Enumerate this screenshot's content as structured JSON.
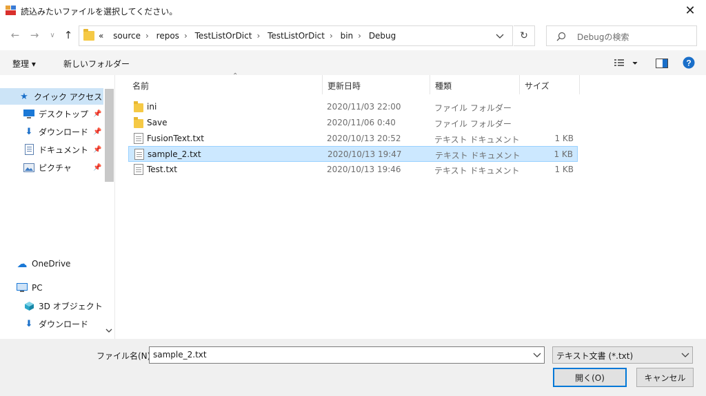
{
  "window": {
    "title": "読込みたいファイルを選択してください。"
  },
  "nav": {
    "back": "←",
    "forward": "→",
    "history": "∨",
    "up": "↑",
    "crumbs_prefix": "«",
    "crumbs": [
      "source",
      "repos",
      "TestListOrDict",
      "TestListOrDict",
      "bin",
      "Debug"
    ],
    "crumb_separator": "›",
    "refresh": "↻"
  },
  "search": {
    "placeholder": "Debugの検索"
  },
  "toolbar": {
    "organize": "整理 ▾",
    "new_folder": "新しいフォルダー"
  },
  "sidebar": {
    "items": [
      {
        "label": "クイック アクセス",
        "icon": "star-icon",
        "glyph": "★"
      },
      {
        "label": "デスクトップ",
        "icon": "desktop-icon",
        "glyph": ""
      },
      {
        "label": "ダウンロード",
        "icon": "download-icon",
        "glyph": "⬇"
      },
      {
        "label": "ドキュメント",
        "icon": "document-icon",
        "glyph": ""
      },
      {
        "label": "ピクチャ",
        "icon": "picture-icon",
        "glyph": ""
      },
      {
        "label": "OneDrive",
        "icon": "cloud-icon",
        "glyph": "☁"
      },
      {
        "label": "PC",
        "icon": "pc-icon",
        "glyph": ""
      },
      {
        "label": "3D オブジェクト",
        "icon": "cube-icon",
        "glyph": ""
      },
      {
        "label": "ダウンロード",
        "icon": "download-icon",
        "glyph": "⬇"
      }
    ]
  },
  "columns": [
    "名前",
    "更新日時",
    "種類",
    "サイズ"
  ],
  "files": [
    {
      "name": "ini",
      "date": "2020/11/03 22:00",
      "type": "ファイル フォルダー",
      "size": "",
      "kind": "folder"
    },
    {
      "name": "Save",
      "date": "2020/11/06 0:40",
      "type": "ファイル フォルダー",
      "size": "",
      "kind": "folder"
    },
    {
      "name": "FusionText.txt",
      "date": "2020/10/13 20:52",
      "type": "テキスト ドキュメント",
      "size": "1 KB",
      "kind": "file"
    },
    {
      "name": "sample_2.txt",
      "date": "2020/10/13 19:47",
      "type": "テキスト ドキュメント",
      "size": "1 KB",
      "kind": "file"
    },
    {
      "name": "Test.txt",
      "date": "2020/10/13 19:46",
      "type": "テキスト ドキュメント",
      "size": "1 KB",
      "kind": "file"
    }
  ],
  "filename": {
    "label": "ファイル名(N):",
    "value": "sample_2.txt"
  },
  "filter": {
    "value": "テキスト文書 (*.txt)"
  },
  "buttons": {
    "open": "開く(O)",
    "cancel": "キャンセル"
  },
  "colors": {
    "selection": "#cce8ff",
    "accent": "#0078d7",
    "help": "#1a6fc9"
  }
}
